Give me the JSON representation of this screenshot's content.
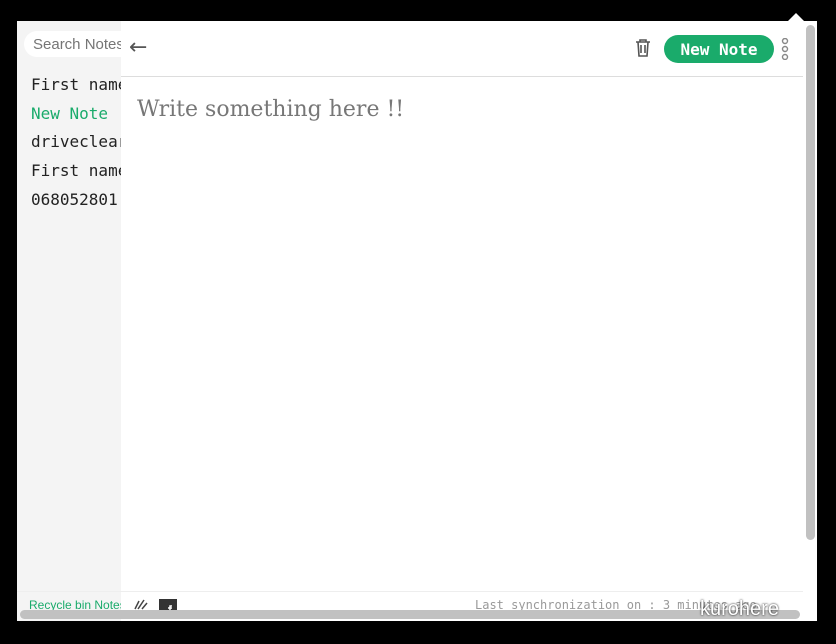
{
  "sidebar": {
    "search_placeholder": "Search Notes",
    "notes": [
      {
        "label": "First name"
      },
      {
        "label": "New Note",
        "active": true
      },
      {
        "label": "driveclear"
      },
      {
        "label": "First name"
      },
      {
        "label": "068052801"
      }
    ],
    "recycle_label": "Recycle bin Notes"
  },
  "header": {
    "new_note_label": "New Note",
    "icons": [
      "arrow-left-icon",
      "trash-icon",
      "more-vertical-icon"
    ]
  },
  "editor": {
    "placeholder": "Write something here !!"
  },
  "footer": {
    "sync_text": "Last synchronization on : 3 minutes ago",
    "icons": [
      "edit-icon",
      "facebook-icon"
    ]
  },
  "watermark": "kurohere",
  "colors": {
    "accent": "#1aab6b"
  }
}
